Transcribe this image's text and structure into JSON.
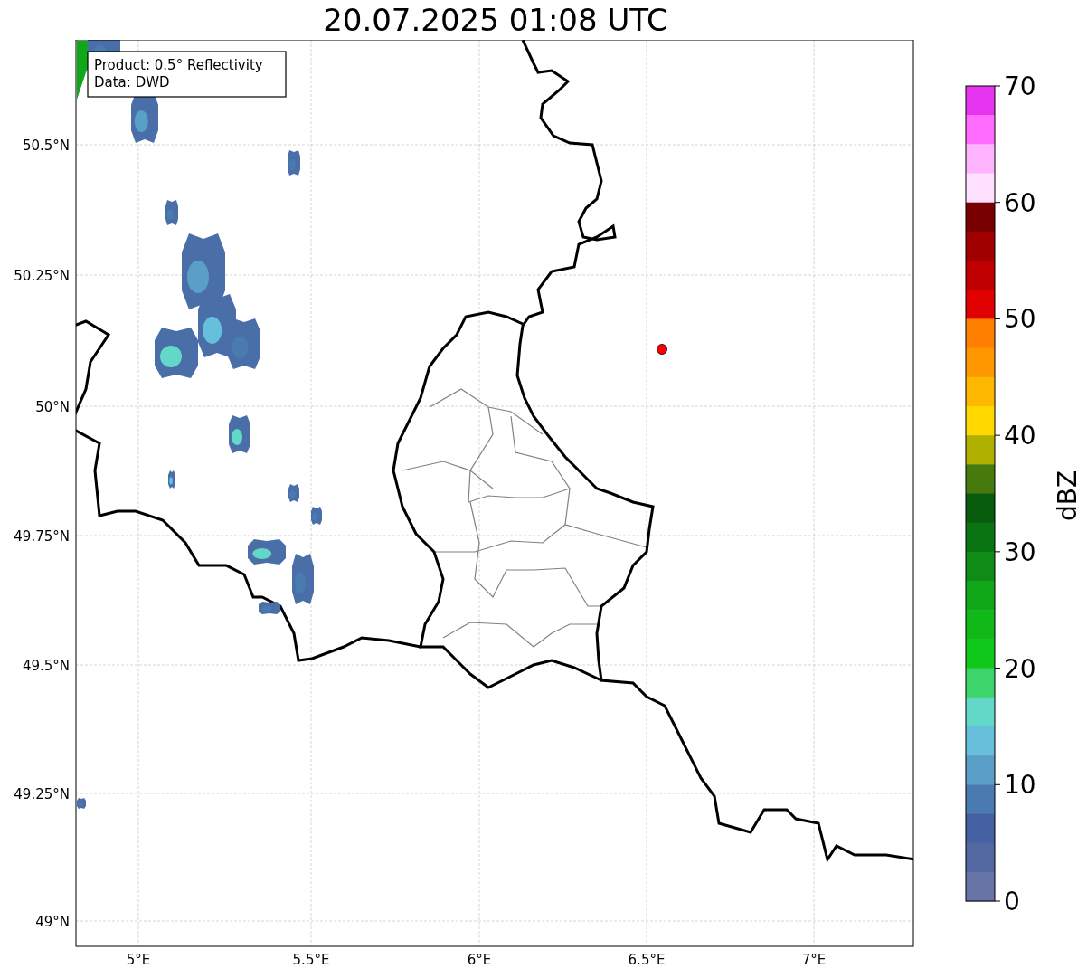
{
  "title": "20.07.2025 01:08 UTC",
  "legend": [
    "Product: 0.5° Reflectivity",
    "Data: DWD"
  ],
  "lat_ticks": [
    "50.5°N",
    "50.25°N",
    "50°N",
    "49.75°N",
    "49.5°N",
    "49.25°N",
    "49°N"
  ],
  "lon_ticks": [
    "5°E",
    "5.5°E",
    "6°E",
    "6.5°E",
    "7°E"
  ],
  "colorbar": {
    "label": "dBZ",
    "ticks": [
      "70",
      "60",
      "50",
      "40",
      "30",
      "20",
      "10",
      "0"
    ],
    "bands": [
      {
        "color": "#e634f0"
      },
      {
        "color": "#ff6cff"
      },
      {
        "color": "#ffb4ff"
      },
      {
        "color": "#ffe0ff"
      },
      {
        "color": "#780000"
      },
      {
        "color": "#a00000"
      },
      {
        "color": "#c00000"
      },
      {
        "color": "#e00000"
      },
      {
        "color": "#ff7f00"
      },
      {
        "color": "#ff9800"
      },
      {
        "color": "#ffb800"
      },
      {
        "color": "#ffd800"
      },
      {
        "color": "#b0b000"
      },
      {
        "color": "#477a0d"
      },
      {
        "color": "#085c0e"
      },
      {
        "color": "#0a7412"
      },
      {
        "color": "#0e8c16"
      },
      {
        "color": "#10a818"
      },
      {
        "color": "#10b818"
      },
      {
        "color": "#10c81a"
      },
      {
        "color": "#3ed46c"
      },
      {
        "color": "#63d8c8"
      },
      {
        "color": "#66c0dc"
      },
      {
        "color": "#5a9fc8"
      },
      {
        "color": "#4a7bb0"
      },
      {
        "color": "#4560a3"
      },
      {
        "color": "#5367a0"
      },
      {
        "color": "#6675a6"
      }
    ]
  }
}
